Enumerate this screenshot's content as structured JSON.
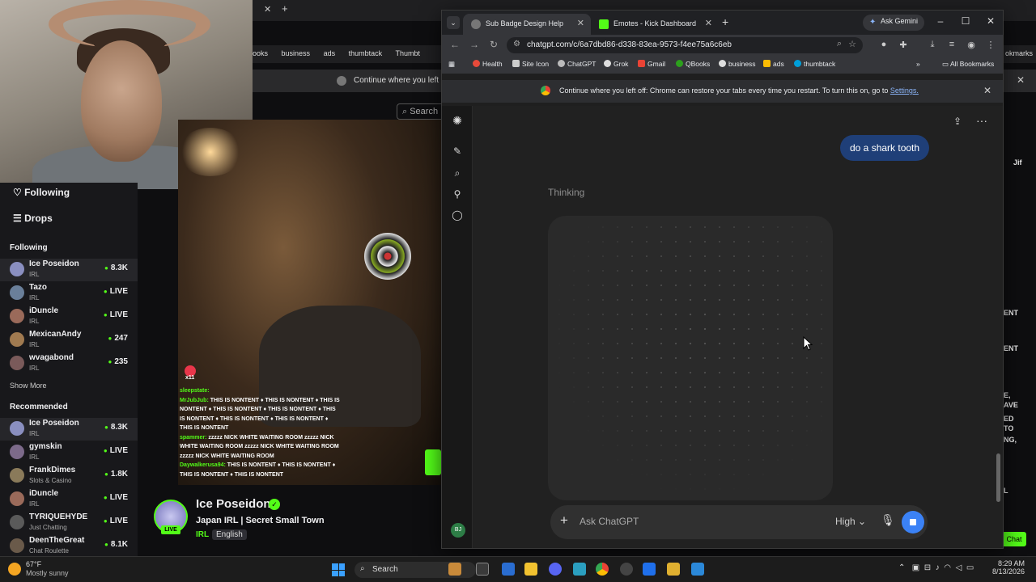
{
  "background_browser": {
    "bookmarks": [
      "ooks",
      "business",
      "ads",
      "thumbtack",
      "Thumbt"
    ],
    "right_bookmarks": "okmarks",
    "infobar_text": "Continue where you left off:",
    "search_label": "Search",
    "right_pane_text": [
      "Jif",
      "ENT",
      "ENT",
      "E,",
      "AVE",
      "ED",
      "TO",
      "NG,",
      "L"
    ],
    "chat_button": "Chat",
    "ask_gemini": "Ask Gemini"
  },
  "kick": {
    "nav_following": "Following",
    "nav_drops": "Drops",
    "following_heading": "Following",
    "following": [
      {
        "name": "Ice Poseidon",
        "category": "IRL",
        "count": "8.3K"
      },
      {
        "name": "Tazo",
        "category": "IRL",
        "count": "LIVE"
      },
      {
        "name": "iDuncle",
        "category": "IRL",
        "count": "LIVE"
      },
      {
        "name": "MexicanAndy",
        "category": "IRL",
        "count": "247"
      },
      {
        "name": "wvagabond",
        "category": "IRL",
        "count": "235"
      }
    ],
    "show_more": "Show More",
    "recommended_heading": "Recommended",
    "recommended": [
      {
        "name": "Ice Poseidon",
        "category": "IRL",
        "count": "8.3K"
      },
      {
        "name": "gymskin",
        "category": "IRL",
        "count": "LIVE"
      },
      {
        "name": "FrankDimes",
        "category": "Slots & Casino",
        "count": "1.8K"
      },
      {
        "name": "iDuncle",
        "category": "IRL",
        "count": "LIVE"
      },
      {
        "name": "TYRIQUEHYDE",
        "category": "Just Chatting",
        "count": "LIVE"
      },
      {
        "name": "DeenTheGreat",
        "category": "Chat Roulette",
        "count": "8.1K"
      }
    ],
    "overlay_chat": [
      {
        "user": "sleepstate:",
        "text": ""
      },
      {
        "user": "MrJubJub:",
        "text": "THIS IS NONTENT ♦ THIS IS NONTENT ♦ THIS IS NONTENT ♦ THIS IS NONTENT ♦ THIS IS NONTENT ♦ THIS IS NONTENT ♦ THIS IS NONTENT ♦ THIS IS NONTENT ♦ THIS IS NONTENT"
      },
      {
        "user": "spammer:",
        "text": "zzzzz NICK WHITE WAITING ROOM zzzzz NICK WHITE WAITING ROOM zzzzz NICK WHITE WAITING ROOM zzzzz NICK WHITE WAITING ROOM"
      },
      {
        "user": "Daywalkerusa94:",
        "text": "THIS IS NONTENT ♦ THIS IS NONTENT ♦ THIS IS NONTENT ♦ THIS IS NONTENT"
      }
    ],
    "overlay_badge": "x11",
    "stream": {
      "streamer": "Ice Poseidon",
      "live_label": "LIVE",
      "title": "Japan IRL | Secret Small Town",
      "category": "IRL",
      "language": "English"
    }
  },
  "chrome": {
    "tabs": [
      {
        "title": "Sub Badge Design Help",
        "active": true
      },
      {
        "title": "Emotes - Kick Dashboard",
        "active": false
      }
    ],
    "ask_gemini": "Ask Gemini",
    "url": "chatgpt.com/c/6a7dbd86-d338-83ea-9573-f4ee75a6c6eb",
    "bookmarks": [
      "Health",
      "Site Icon",
      "ChatGPT",
      "Grok",
      "Gmail",
      "QBooks",
      "business",
      "ads",
      "thumbtack"
    ],
    "all_bookmarks": "All Bookmarks",
    "infobar": {
      "message": "Continue where you left off: Chrome can restore your tabs every time you restart. To turn this on, go to ",
      "link": "Settings."
    }
  },
  "chatgpt": {
    "user_message": "do a shark tooth",
    "status": "Thinking",
    "composer_placeholder": "Ask ChatGPT",
    "mode": "High",
    "avatar_initials": "BJ"
  },
  "taskbar": {
    "weather_temp": "67°F",
    "weather_desc": "Mostly sunny",
    "search_label": "Search",
    "time": "8:29 AM",
    "date": "8/13/2026"
  }
}
